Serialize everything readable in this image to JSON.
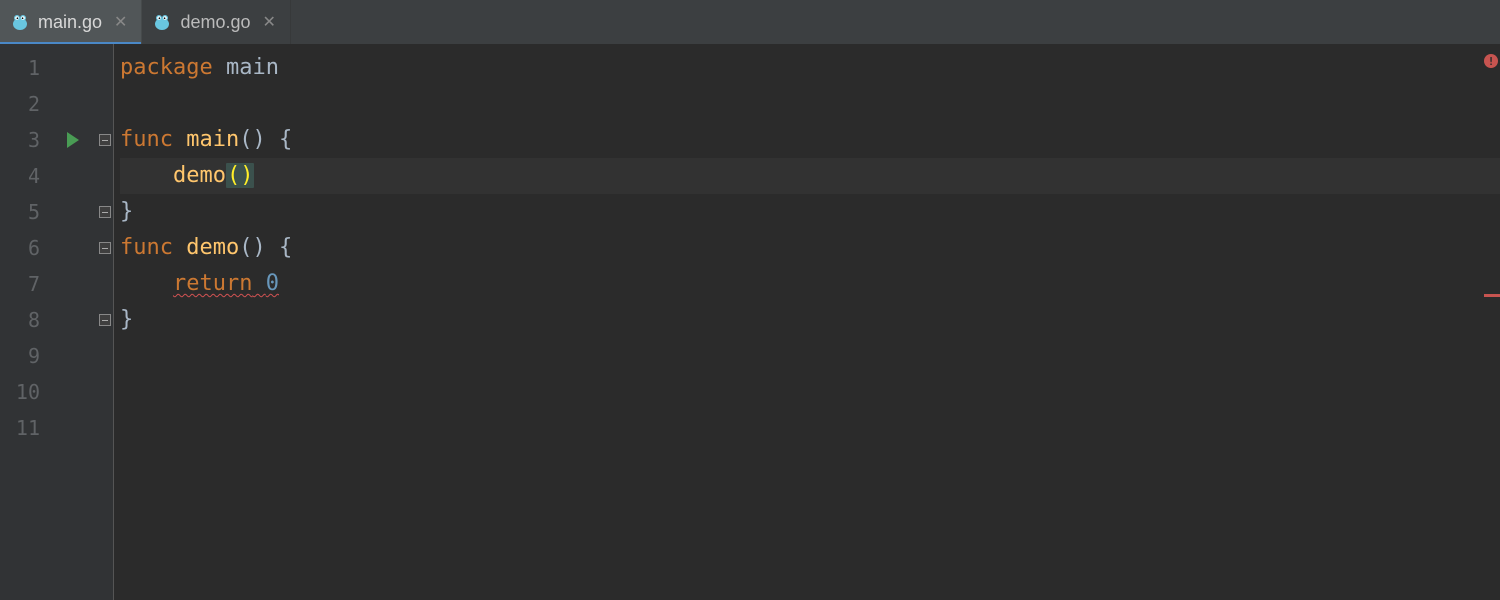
{
  "tabs": [
    {
      "label": "main.go",
      "active": true
    },
    {
      "label": "demo.go",
      "active": false
    }
  ],
  "line_numbers": [
    "1",
    "2",
    "3",
    "4",
    "5",
    "6",
    "7",
    "8",
    "9",
    "10",
    "11"
  ],
  "code": {
    "kw_package": "package",
    "pkg_main": "main",
    "kw_func_1": "func",
    "fn_main": "main",
    "brace_open_1": "() {",
    "call_demo": "demo",
    "call_parens": "()",
    "brace_close_1": "}",
    "kw_func_2": "func",
    "fn_demo": "demo",
    "brace_open_2": "() {",
    "kw_return": "return",
    "ret_space": " ",
    "lit_zero": "0",
    "brace_close_2": "}"
  },
  "indent4": "    ",
  "error_badge": "!"
}
